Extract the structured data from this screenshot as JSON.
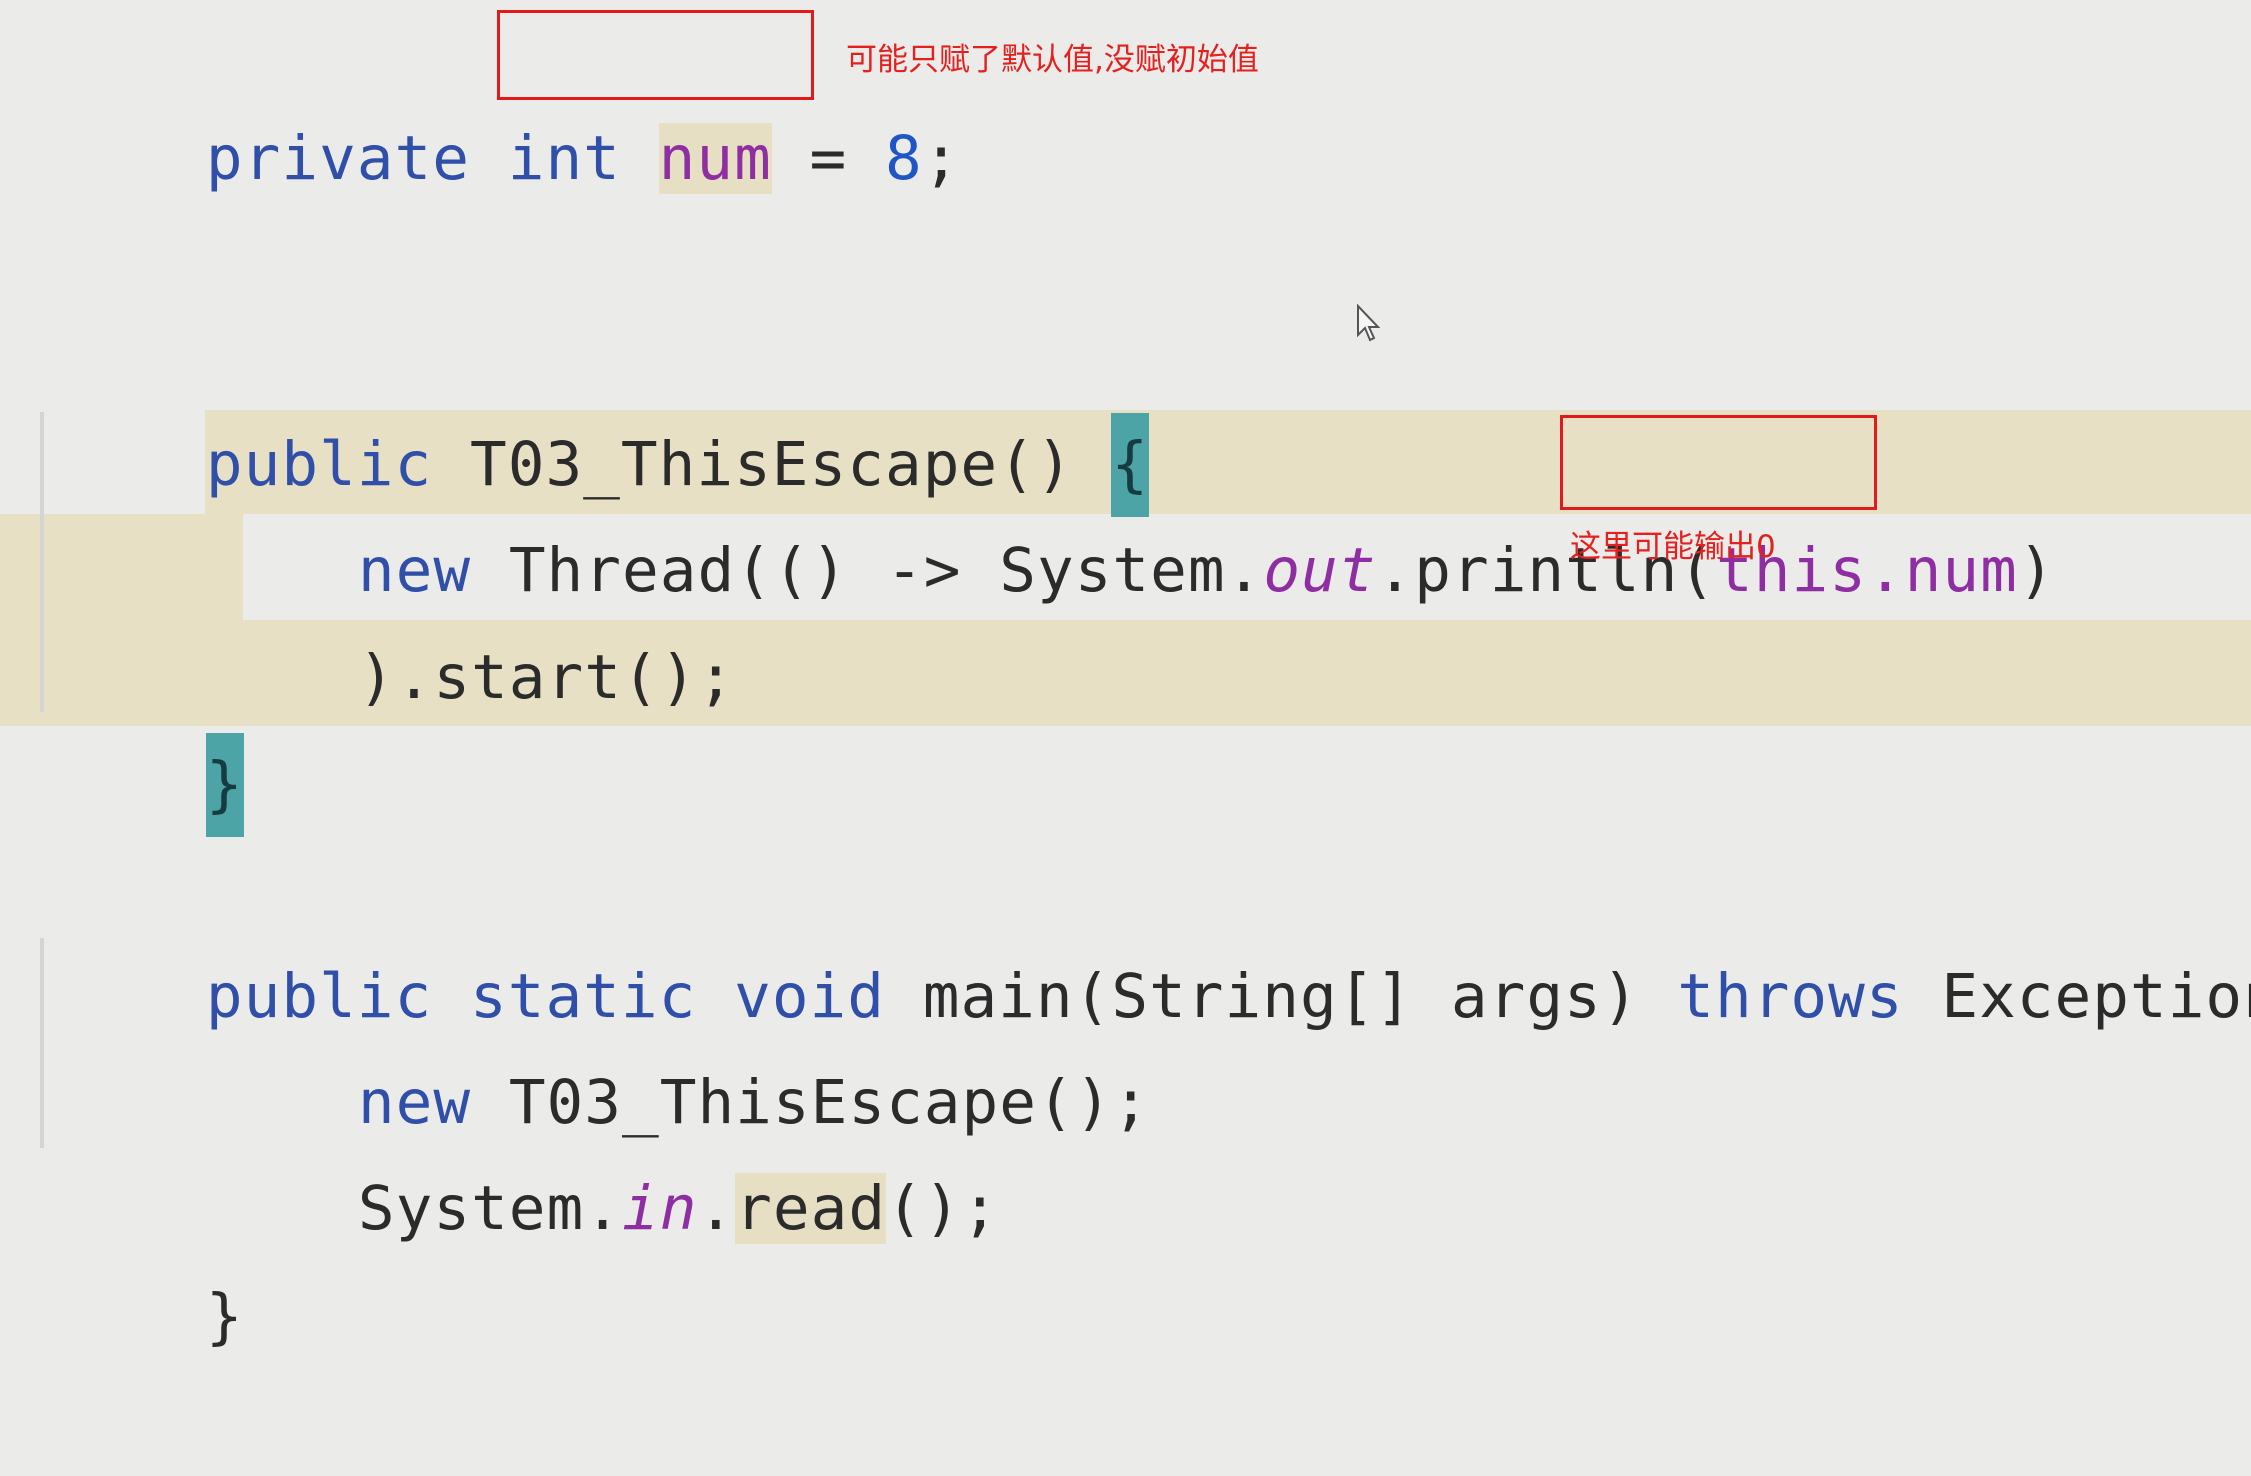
{
  "code": {
    "line1": {
      "kw_private": "private",
      "kw_int": "int",
      "field_num": "num",
      "equals": " = ",
      "value": "8",
      "semicolon": ";"
    },
    "line2": {
      "kw_public": "public",
      "constructor": " T03_ThisEscape() ",
      "brace": "{"
    },
    "line3": {
      "kw_new": "new",
      "thread_prefix": " Thread(() -> System.",
      "out_field": "out",
      "println_part": ".println(",
      "this_num": "this.num",
      "close_paren": ")"
    },
    "line4": {
      "start_call": ").start();"
    },
    "line5": {
      "closing_brace": "}"
    },
    "line6": {
      "kw_public": "public",
      "kw_static": "static",
      "kw_void": "void",
      "main_signature": "main(String[] args)",
      "kw_throws": "throws",
      "exception_part": "Exception {"
    },
    "line7": {
      "kw_new": "new",
      "ctor_call": " T03_ThisEscape();"
    },
    "line8": {
      "system_prefix": "System.",
      "in_field": "in",
      "dot": ".",
      "read_method": "read",
      "read_tail": "();"
    },
    "line9": {
      "closing_brace": "}"
    }
  },
  "annotations": {
    "note_default_value": "可能只赋了默认值,没赋初始值",
    "note_output_zero": "这里可能输出0"
  },
  "colors": {
    "background": "#ebebe9",
    "keyword": "#2f4fa8",
    "field": "#8e2ea2",
    "annotation": "#e4211f",
    "highlight_band": "#e8e0c4",
    "matching_brace": "#4da4a6"
  },
  "icons": {
    "cursor": "mouse-pointer-icon"
  }
}
